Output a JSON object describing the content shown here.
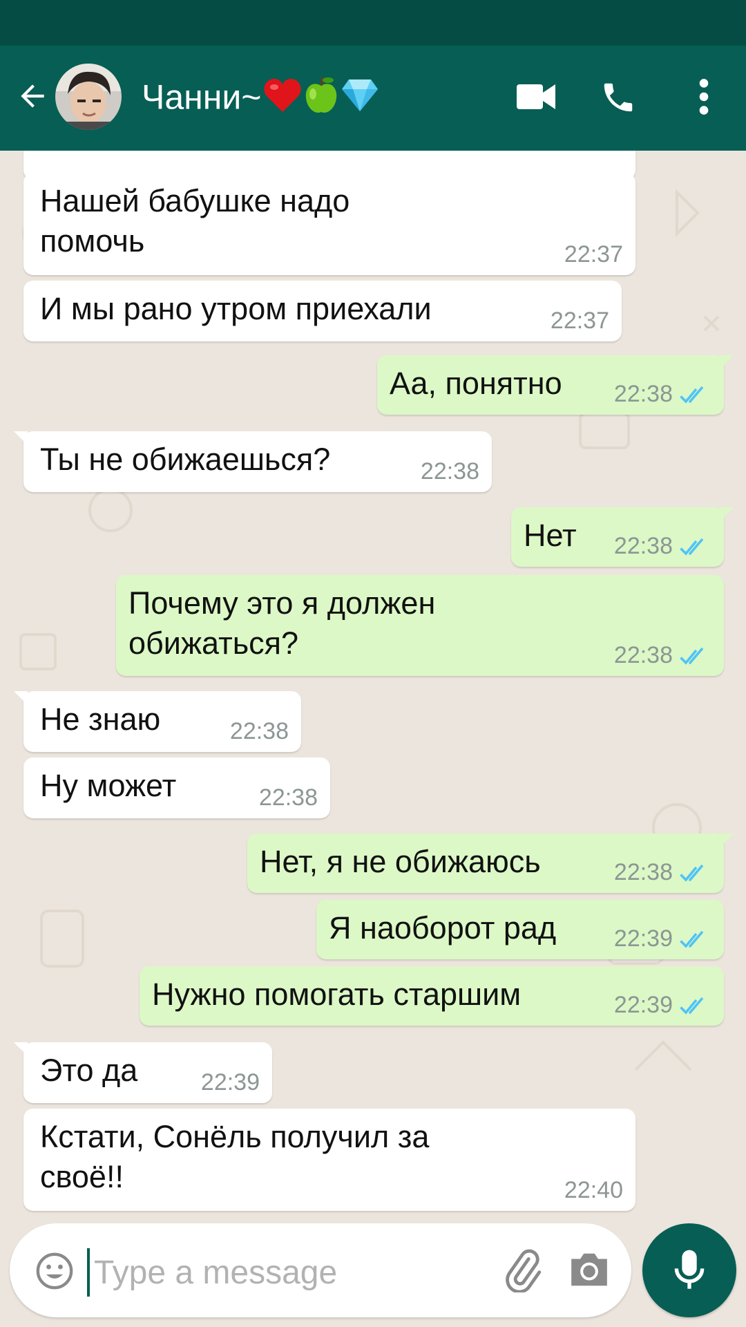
{
  "colors": {
    "header": "#075e54",
    "status_bar": "#054d44",
    "outgoing_bubble": "#dcf8c6",
    "incoming_bubble": "#ffffff",
    "chat_background": "#ece5dd",
    "read_ticks": "#4fc3f7"
  },
  "header": {
    "contact_name": "Чанни~",
    "name_emojis": [
      "❤️",
      "🍏",
      "💎"
    ],
    "icons": [
      "back-arrow-icon",
      "avatar",
      "video-call-icon",
      "phone-call-icon",
      "more-vert-icon"
    ]
  },
  "messages": [
    {
      "direction": "in",
      "text": "Нашей бабушке надо помочь",
      "time": "22:37"
    },
    {
      "direction": "in",
      "text": "И мы рано утром приехали",
      "time": "22:37"
    },
    {
      "direction": "out",
      "text": "Аа, понятно",
      "time": "22:38",
      "status": "read"
    },
    {
      "direction": "in",
      "text": "Ты не обижаешься?",
      "time": "22:38"
    },
    {
      "direction": "out",
      "text": "Нет",
      "time": "22:38",
      "status": "read"
    },
    {
      "direction": "out",
      "text": "Почему это я должен обижаться?",
      "time": "22:38",
      "status": "read"
    },
    {
      "direction": "in",
      "text": "Не знаю",
      "time": "22:38"
    },
    {
      "direction": "in",
      "text": "Ну может",
      "time": "22:38"
    },
    {
      "direction": "out",
      "text": "Нет, я не обижаюсь",
      "time": "22:38",
      "status": "read"
    },
    {
      "direction": "out",
      "text": "Я наоборот рад",
      "time": "22:39",
      "status": "read"
    },
    {
      "direction": "out",
      "text": "Нужно помогать старшим",
      "time": "22:39",
      "status": "read"
    },
    {
      "direction": "in",
      "text": "Это да",
      "time": "22:39"
    },
    {
      "direction": "in",
      "text": "Кстати, Сонёль получил за своё!!",
      "time": "22:40"
    }
  ],
  "input": {
    "placeholder": "Type a message",
    "value": ""
  }
}
